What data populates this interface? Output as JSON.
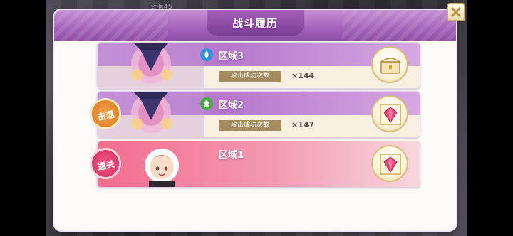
{
  "background": {
    "top_info": "还有45"
  },
  "modal": {
    "title": "战斗履历",
    "close_icon": "close-icon"
  },
  "rows": [
    {
      "zone_label": "区域3",
      "zone_icon": "water-drop-icon",
      "zone_icon_color": "#2f8fe0",
      "stat_label": "攻击成功次数",
      "stat_value": "×144",
      "reward_icon": "treasure-chest-icon",
      "badge": ""
    },
    {
      "zone_label": "区域2",
      "zone_icon": "tree-icon",
      "zone_icon_color": "#3fae3c",
      "stat_label": "攻击成功次数",
      "stat_value": "×147",
      "reward_icon": "magic-gem-icon",
      "badge": "击退"
    },
    {
      "zone_label": "区域1",
      "zone_icon": "",
      "stat_label": "",
      "stat_value": "",
      "reward_icon": "magic-gem-icon",
      "badge": "通关"
    }
  ],
  "colors": {
    "header_purple": "#a262b9",
    "row_purple": "#c48bd6",
    "row_pink": "#f36d8d",
    "defeat_badge": "#e1852b",
    "clear_badge": "#dc3a69",
    "stat_label_bg": "#a38b5e"
  }
}
